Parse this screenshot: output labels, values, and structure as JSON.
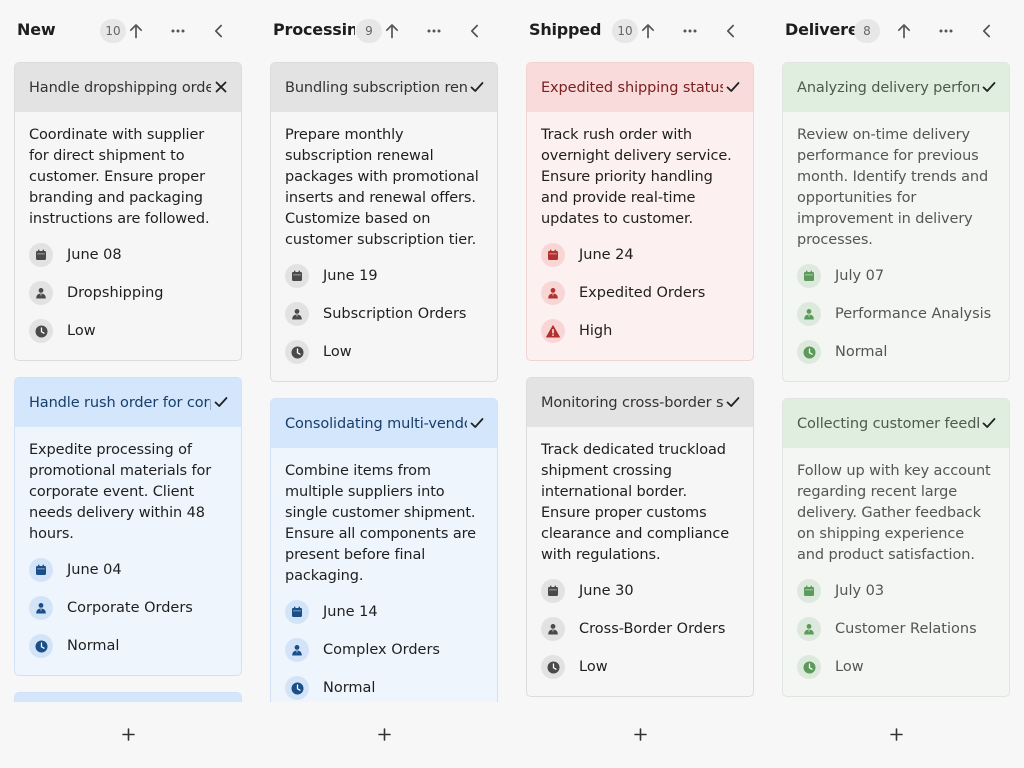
{
  "colors": {
    "grey_icon": "#4a4a4a",
    "blue_icon": "#1b4f8a",
    "red_icon": "#b23030",
    "green_icon": "#5c9a5c",
    "header_icon": "#555555"
  },
  "columns": [
    {
      "title": "New",
      "count": "10",
      "cards": [
        {
          "variant": "grey",
          "title": "Handle dropshipping orders",
          "action": "close",
          "description": "Coordinate with supplier for direct shipment to customer. Ensure proper branding and packaging instructions are followed.",
          "date": "June 08",
          "category": "Dropshipping",
          "priority": "Low",
          "priority_icon": "clock"
        },
        {
          "variant": "blue",
          "title": "Handle rush order for corporate event",
          "action": "check",
          "description": "Expedite processing of promotional materials for corporate event. Client needs delivery within 48 hours.",
          "date": "June 04",
          "category": "Corporate Orders",
          "priority": "Normal",
          "priority_icon": "clock"
        },
        {
          "variant": "blue",
          "title": "",
          "action": "",
          "description": "",
          "date": "",
          "category": "",
          "priority": "",
          "priority_icon": "clock",
          "stub": true
        }
      ]
    },
    {
      "title": "Processing",
      "count": "9",
      "cards": [
        {
          "variant": "grey",
          "title": "Bundling subscription renewals",
          "action": "check",
          "description": "Prepare monthly subscription renewal packages with promotional inserts and renewal offers. Customize based on customer subscription tier.",
          "date": "June 19",
          "category": "Subscription Orders",
          "priority": "Low",
          "priority_icon": "clock"
        },
        {
          "variant": "blue",
          "title": "Consolidating multi-vendor order",
          "action": "check",
          "description": "Combine items from multiple suppliers into single customer shipment. Ensure all components are present before final packaging.",
          "date": "June 14",
          "category": "Complex Orders",
          "priority": "Normal",
          "priority_icon": "clock"
        }
      ]
    },
    {
      "title": "Shipped",
      "count": "10",
      "cards": [
        {
          "variant": "red",
          "title": "Expedited shipping status update",
          "action": "check",
          "description": "Track rush order with overnight delivery service. Ensure priority handling and provide real-time updates to customer.",
          "date": "June 24",
          "category": "Expedited Orders",
          "priority": "High",
          "priority_icon": "warning"
        },
        {
          "variant": "grey",
          "title": "Monitoring cross-border shipment",
          "action": "check",
          "description": "Track dedicated truckload shipment crossing international border. Ensure proper customs clearance and compliance with regulations.",
          "date": "June 30",
          "category": "Cross-Border Orders",
          "priority": "Low",
          "priority_icon": "clock"
        }
      ]
    },
    {
      "title": "Delivered",
      "count": "8",
      "cards": [
        {
          "variant": "green",
          "title": "Analyzing delivery performance",
          "action": "check",
          "description": "Review on-time delivery performance for previous month. Identify trends and opportunities for improvement in delivery processes.",
          "date": "July 07",
          "category": "Performance Analysis",
          "priority": "Normal",
          "priority_icon": "clock"
        },
        {
          "variant": "green",
          "title": "Collecting customer feedback",
          "action": "check",
          "description": "Follow up with key account regarding recent large delivery. Gather feedback on shipping experience and product satisfaction.",
          "date": "July 03",
          "category": "Customer Relations",
          "priority": "Low",
          "priority_icon": "clock"
        }
      ]
    }
  ]
}
